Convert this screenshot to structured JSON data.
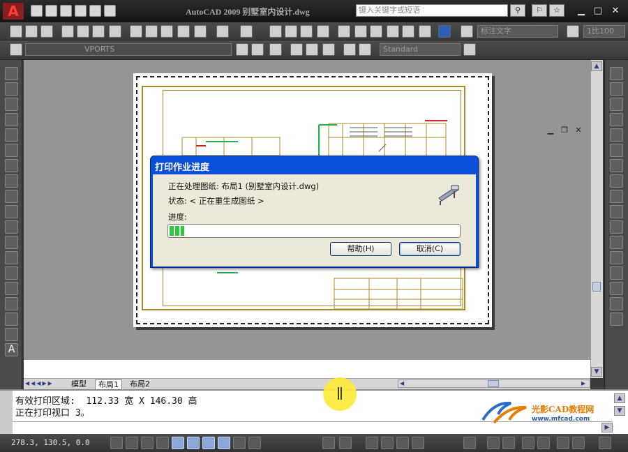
{
  "window": {
    "title": "AutoCAD 2009 别墅室内设计.dwg",
    "search_placeholder": "键入关键字或短语",
    "minimize": "▁",
    "maximize": "□",
    "close": "✕"
  },
  "toolbars": {
    "text_style": "标注文字",
    "scale": "1比100",
    "layer": "VPORTS",
    "style": "Standard"
  },
  "layout_tabs": [
    "模型",
    "布局1",
    "布局2"
  ],
  "command_lines": [
    "有效打印区域:  112.33 宽 X 146.30 高",
    "正在打印视口 3。"
  ],
  "status": {
    "coordinates": "278.3, 130.5, 0.0"
  },
  "dialog": {
    "title": "打印作业进度",
    "processing_line": "正在处理图纸: 布局1 (别墅室内设计.dwg)",
    "state_line": "状态: < 正在重生成图纸 >",
    "progress_label": "进度:",
    "progress_value": 0.05,
    "help_button": "帮助(H)",
    "cancel_button": "取消(C)"
  },
  "watermark": {
    "brand": "光影CAD教程网",
    "url": "www.mfcad.com"
  },
  "colors": {
    "dialog_title": "#0a4fd9",
    "progress": "#2ec83a",
    "frame": "#a8882a",
    "highlight": "#ffeb3b"
  }
}
